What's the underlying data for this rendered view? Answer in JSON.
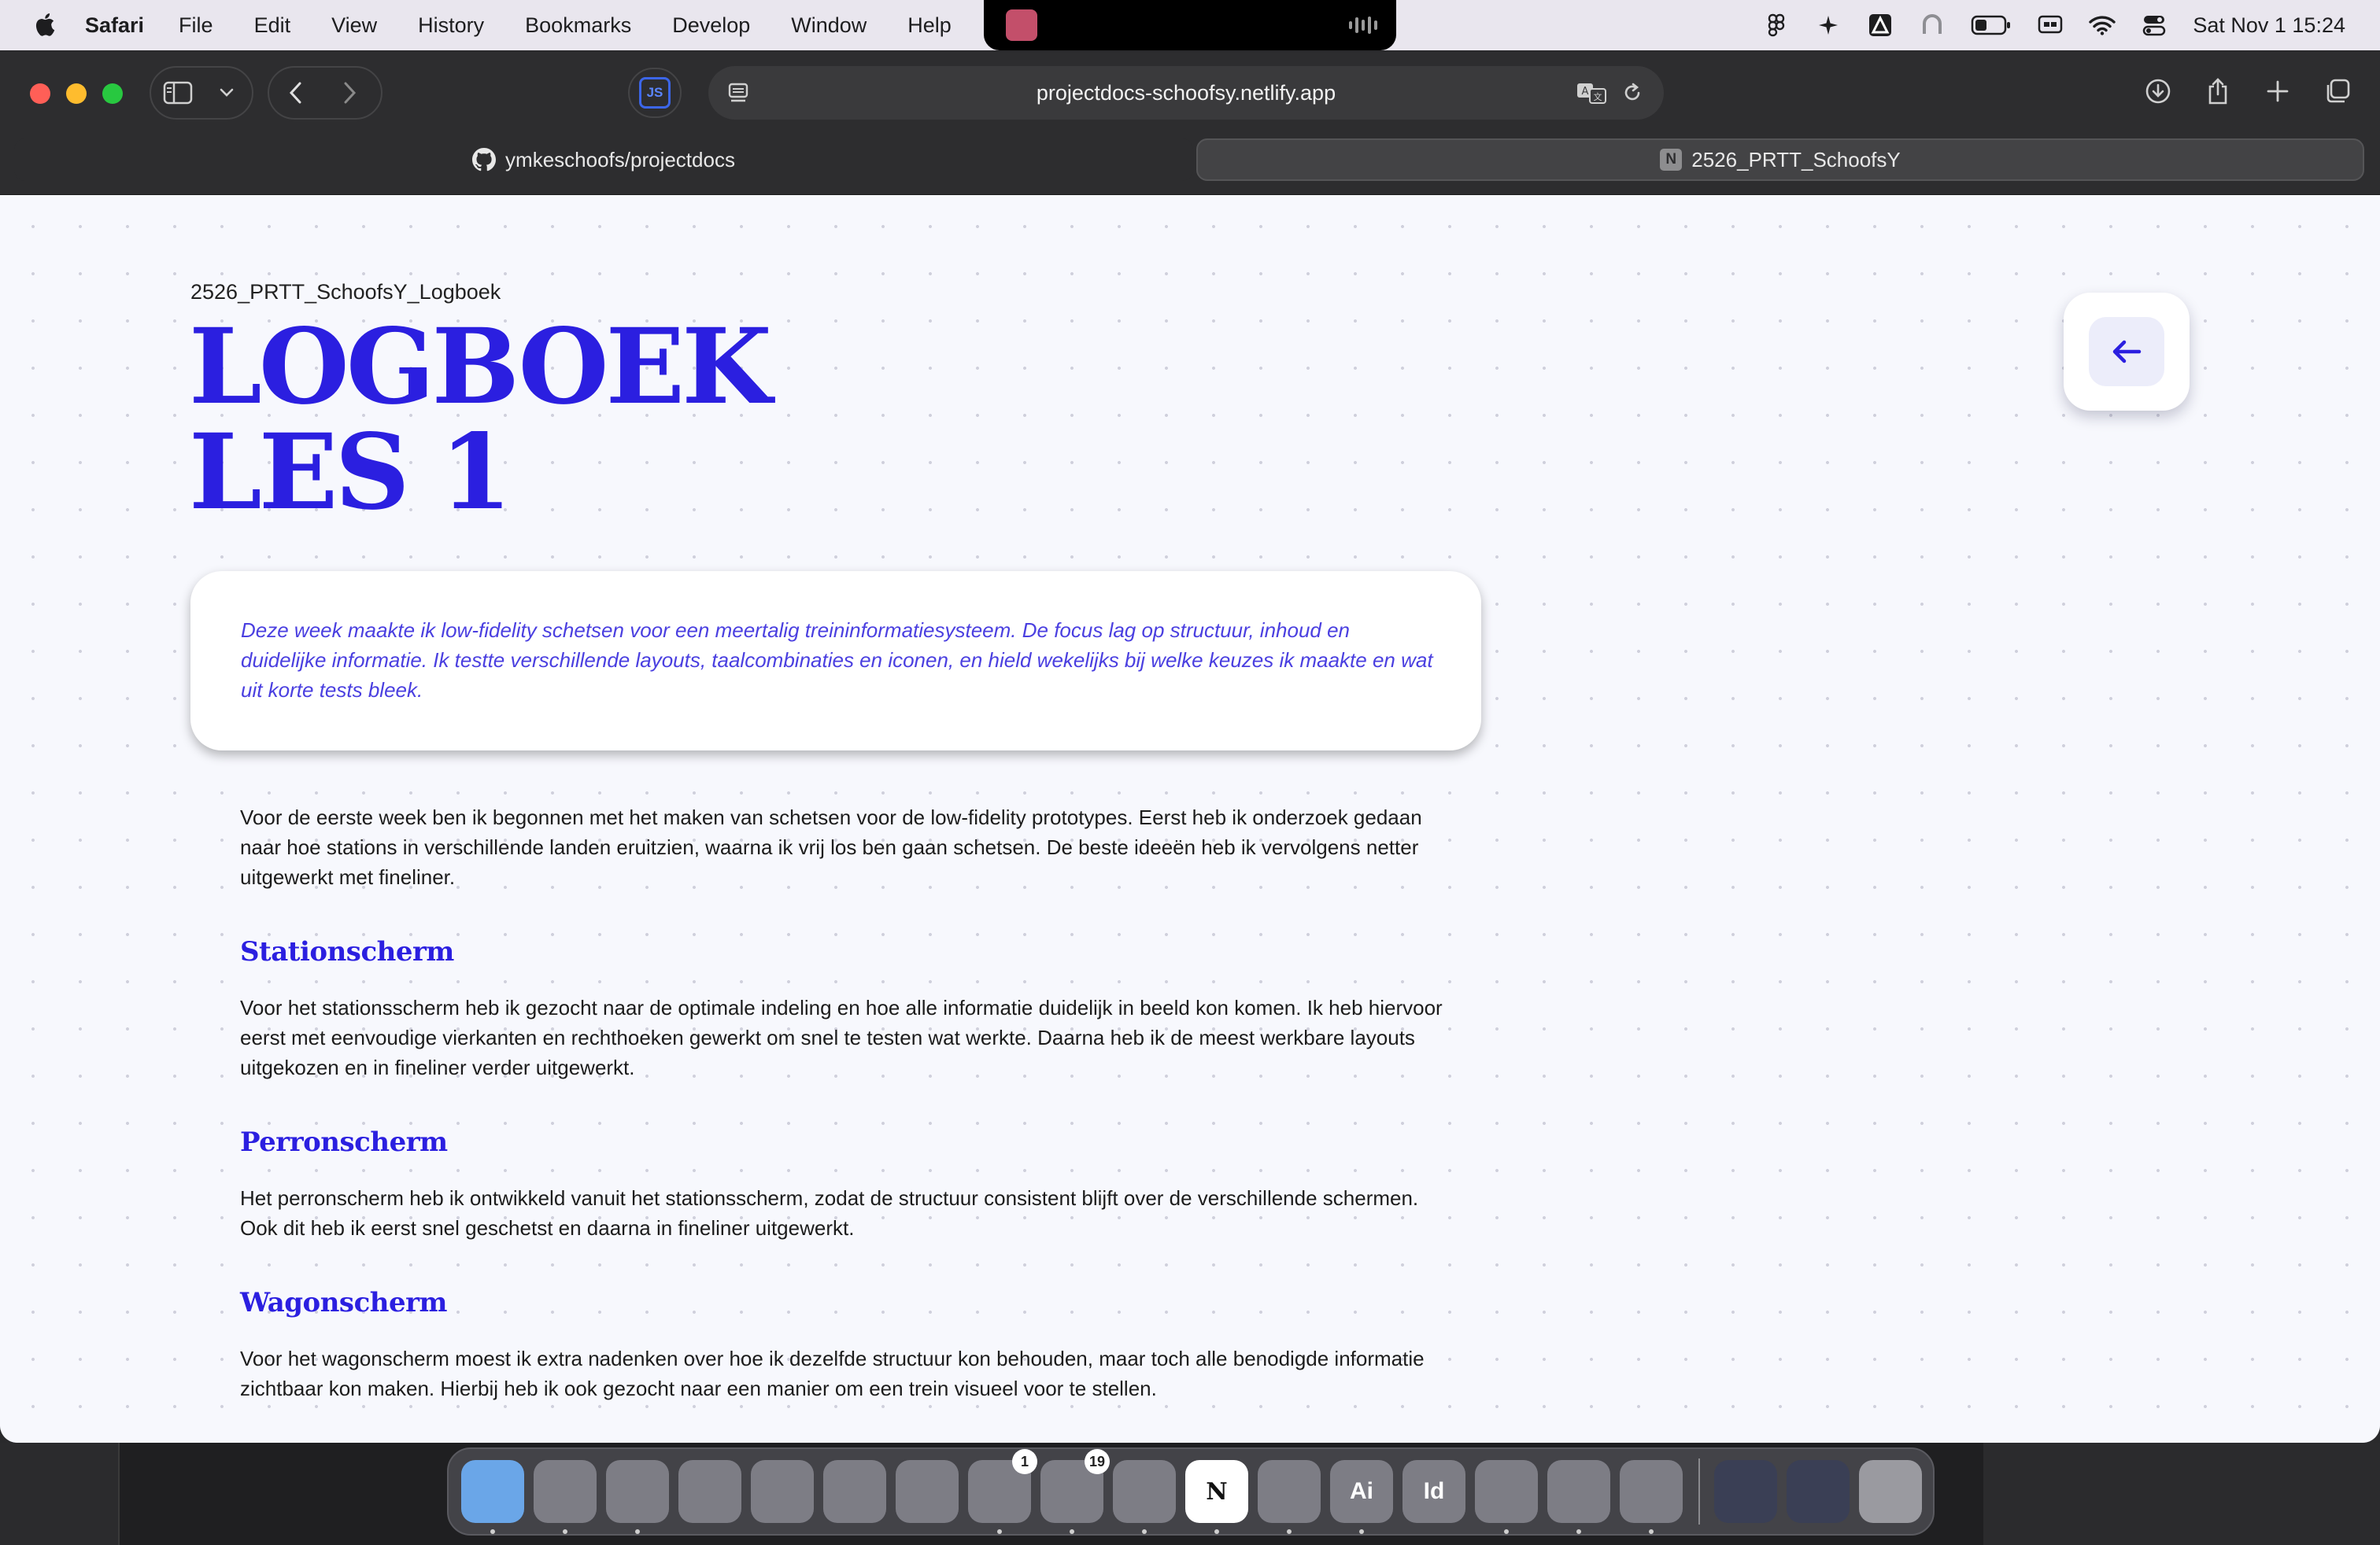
{
  "menubar": {
    "app_name": "Safari",
    "menus": [
      "File",
      "Edit",
      "View",
      "History",
      "Bookmarks",
      "Develop",
      "Window",
      "Help"
    ],
    "datetime": "Sat Nov 1  15:24"
  },
  "browser": {
    "url": "projectdocs-schoofsy.netlify.app",
    "extension_label": "JS",
    "tabs": [
      {
        "title": "ymkeschoofs/projectdocs",
        "icon": "github-icon"
      },
      {
        "title": "2526_PRTT_SchoofsY",
        "icon": "notion-icon",
        "active": true
      }
    ]
  },
  "page": {
    "breadcrumb": "2526_PRTT_SchoofsY_Logboek",
    "title_line1": "LOGBOEK",
    "title_line2": "LES 1",
    "intro": "Deze week maakte ik low-fidelity schetsen voor een meertalig treininformatiesysteem. De focus lag op structuur, inhoud en duidelijke informatie. Ik testte verschillende layouts, taalcombinaties en iconen, en hield wekelijks bij welke keuzes ik maakte en wat uit korte tests bleek.",
    "paragraph_intro": "Voor de eerste week ben ik begonnen met het maken van schetsen voor de low-fidelity prototypes. Eerst heb ik onderzoek gedaan naar hoe stations in verschillende landen eruitzien, waarna ik vrij los ben gaan schetsen. De beste ideeën heb ik vervolgens netter uitgewerkt met fineliner.",
    "sections": [
      {
        "heading": "Stationscherm",
        "text": "Voor het stationsscherm heb ik gezocht naar de optimale indeling en hoe alle informatie duidelijk in beeld kon komen. Ik heb hiervoor eerst met eenvoudige vierkanten en rechthoeken gewerkt om snel te testen wat werkte. Daarna heb ik de meest werkbare layouts uitgekozen en in fineliner verder uitgewerkt."
      },
      {
        "heading": "Perronscherm",
        "text": "Het perronscherm heb ik ontwikkeld vanuit het stationsscherm, zodat de structuur consistent blijft over de verschillende schermen. Ook dit heb ik eerst snel geschetst en daarna in fineliner uitgewerkt."
      },
      {
        "heading": "Wagonscherm",
        "text": "Voor het wagonscherm moest ik extra nadenken over hoe ik dezelfde structuur kon behouden, maar toch alle benodigde informatie zichtbaar kon maken. Hierbij heb ik ook gezocht naar een manier om een trein visueel voor te stellen."
      }
    ]
  },
  "dock": {
    "apps": [
      {
        "name": "finder",
        "label": "",
        "color": "#6aa6e8"
      },
      {
        "name": "launchpad",
        "label": "",
        "color": "#7d7d85"
      },
      {
        "name": "safari",
        "label": "",
        "color": "#7d7d85"
      },
      {
        "name": "mail",
        "label": "",
        "color": "#7d7d85"
      },
      {
        "name": "notes",
        "label": "",
        "color": "#7d7d85"
      },
      {
        "name": "freeform",
        "label": "",
        "color": "#7d7d85"
      },
      {
        "name": "app-store",
        "label": "",
        "color": "#7d7d85"
      },
      {
        "name": "system-settings",
        "label": "",
        "color": "#7d7d85",
        "badge": "1"
      },
      {
        "name": "discord",
        "label": "",
        "color": "#7d7d85",
        "badge": "19"
      },
      {
        "name": "spotify",
        "label": "",
        "color": "#7d7d85"
      },
      {
        "name": "notion",
        "label": "N",
        "color": "#ffffff"
      },
      {
        "name": "creative-cloud",
        "label": "",
        "color": "#7d7d85"
      },
      {
        "name": "illustrator",
        "label": "Ai",
        "color": "#7d7d85"
      },
      {
        "name": "indesign",
        "label": "Id",
        "color": "#7d7d85"
      },
      {
        "name": "vscode",
        "label": "",
        "color": "#7d7d85"
      },
      {
        "name": "usb-drive",
        "label": "",
        "color": "#7d7d85"
      },
      {
        "name": "figma",
        "label": "",
        "color": "#7d7d85"
      }
    ]
  },
  "colors": {
    "accent": "#2b1fe0",
    "intro_text": "#4a3fe0",
    "page_bg": "#f7f8fd"
  }
}
